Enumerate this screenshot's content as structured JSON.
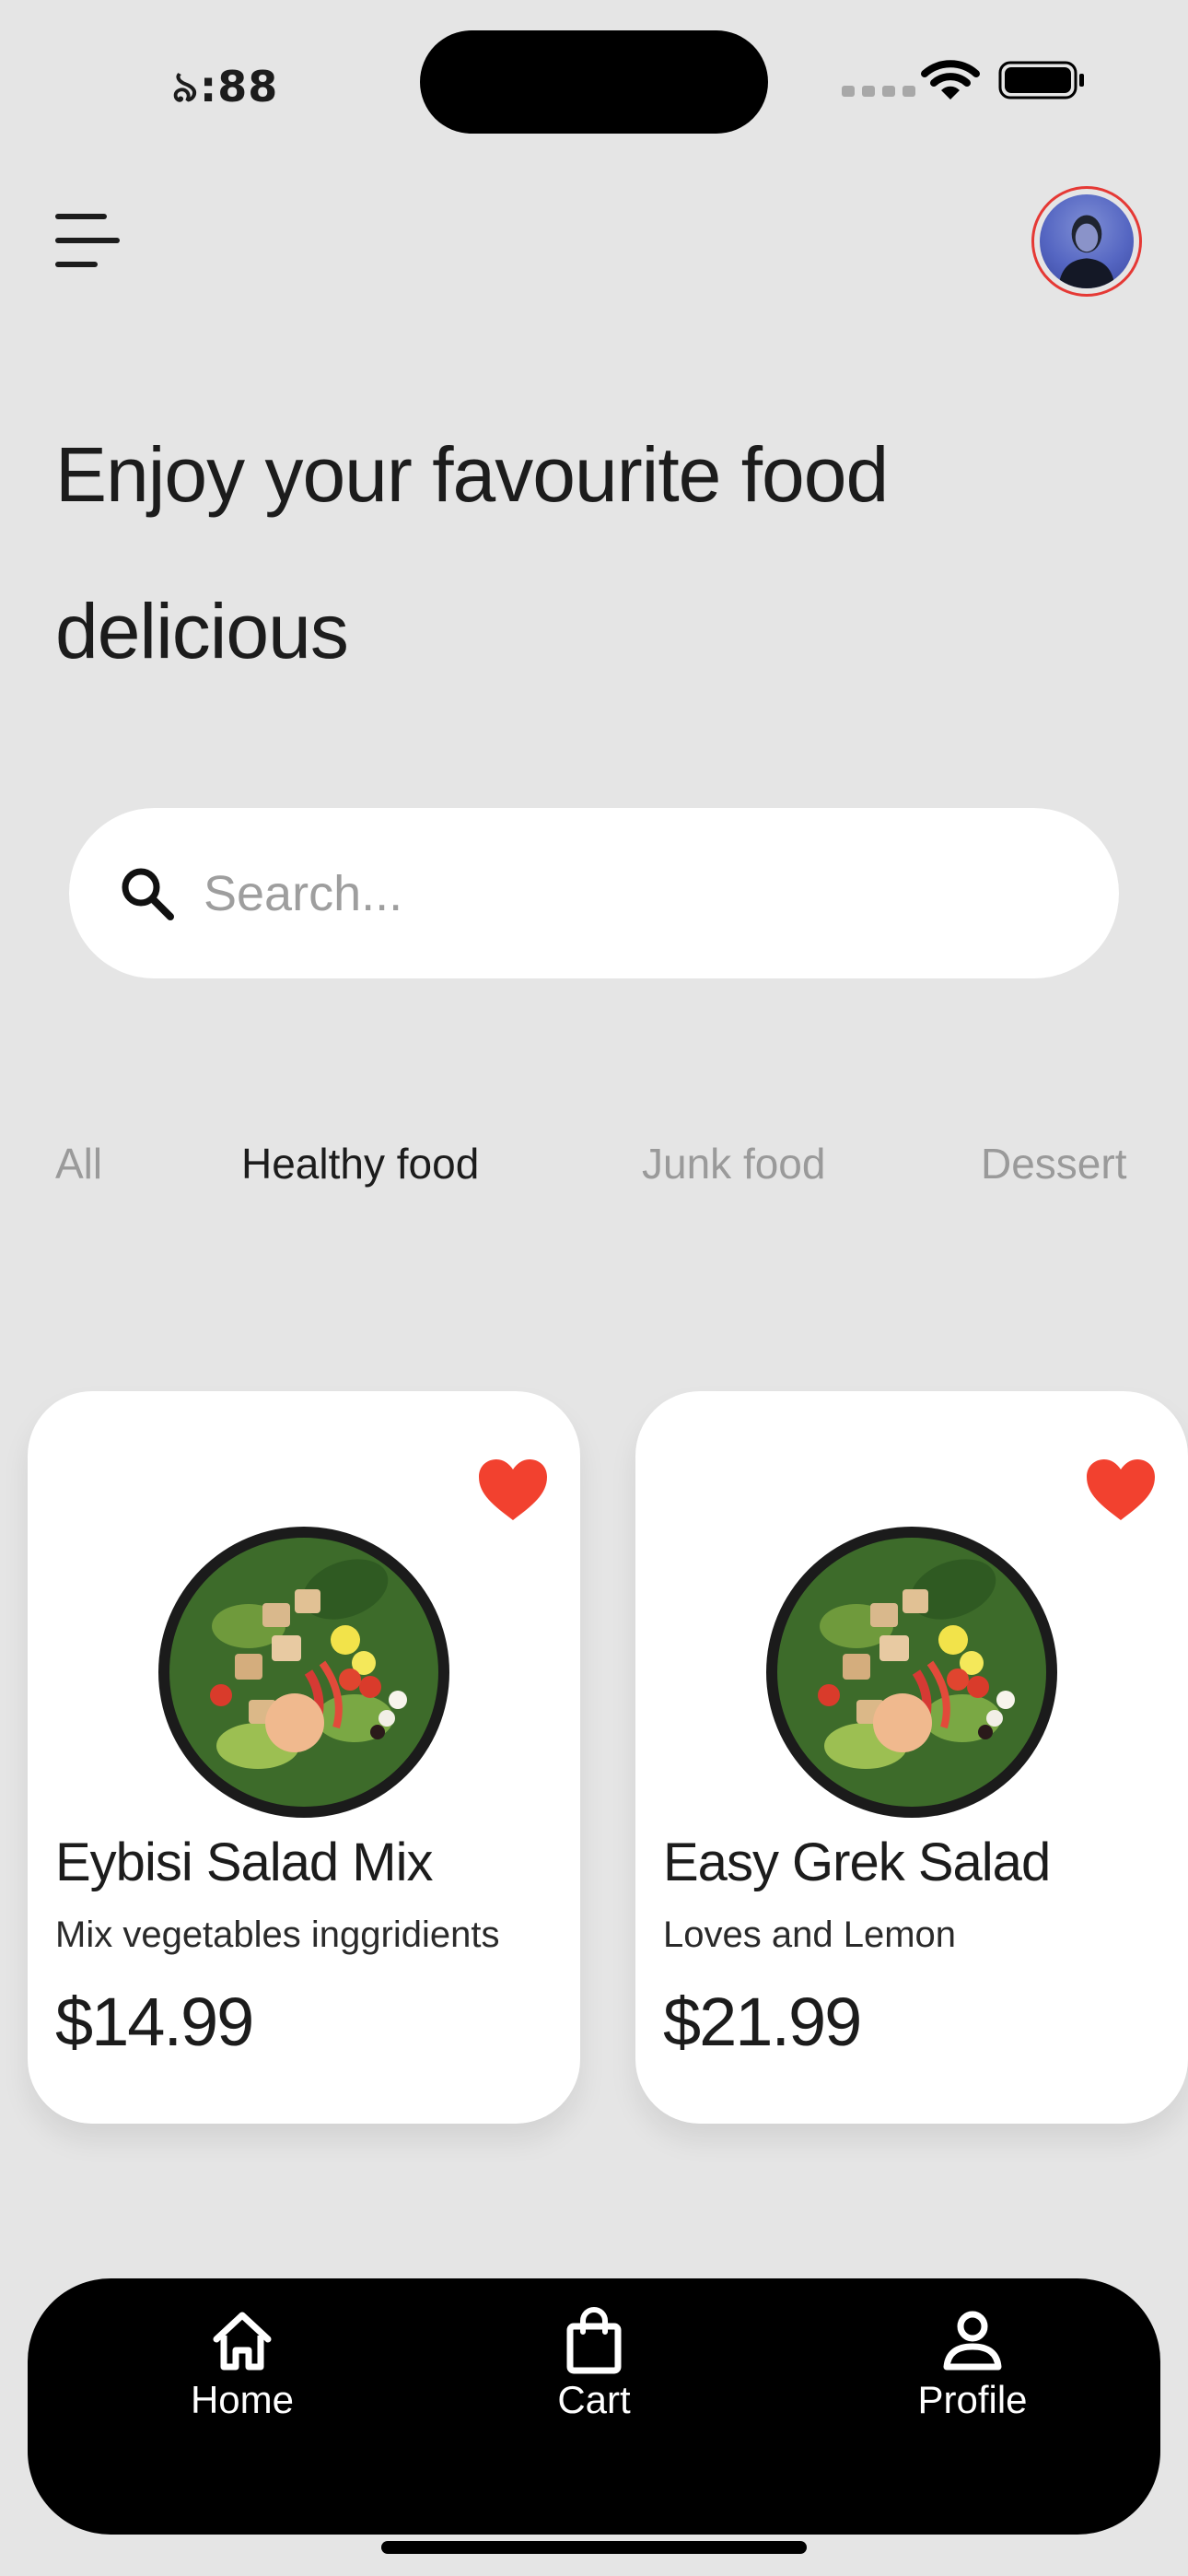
{
  "status_bar": {
    "time": "৯:88"
  },
  "header": {
    "avatar_alt": "user avatar"
  },
  "headline": "Enjoy your favourite food delicious",
  "search": {
    "placeholder": "Search..."
  },
  "categories": [
    {
      "label": "All",
      "active": false
    },
    {
      "label": "Healthy food",
      "active": true
    },
    {
      "label": "Junk food",
      "active": false
    },
    {
      "label": "Dessert",
      "active": false
    }
  ],
  "products": [
    {
      "name": "Eybisi Salad Mix",
      "description": "Mix vegetables inggridients",
      "price": "$14.99",
      "favorite": true
    },
    {
      "name": "Easy Grek Salad",
      "description": "Loves and Lemon",
      "price": "$21.99",
      "favorite": true
    }
  ],
  "bottom_nav": [
    {
      "label": "Home",
      "icon": "home-icon"
    },
    {
      "label": "Cart",
      "icon": "shopping-bag-icon"
    },
    {
      "label": "Profile",
      "icon": "person-icon"
    }
  ],
  "colors": {
    "accent": "#e53935",
    "background": "#e5e5e5",
    "nav_background": "#000000"
  }
}
